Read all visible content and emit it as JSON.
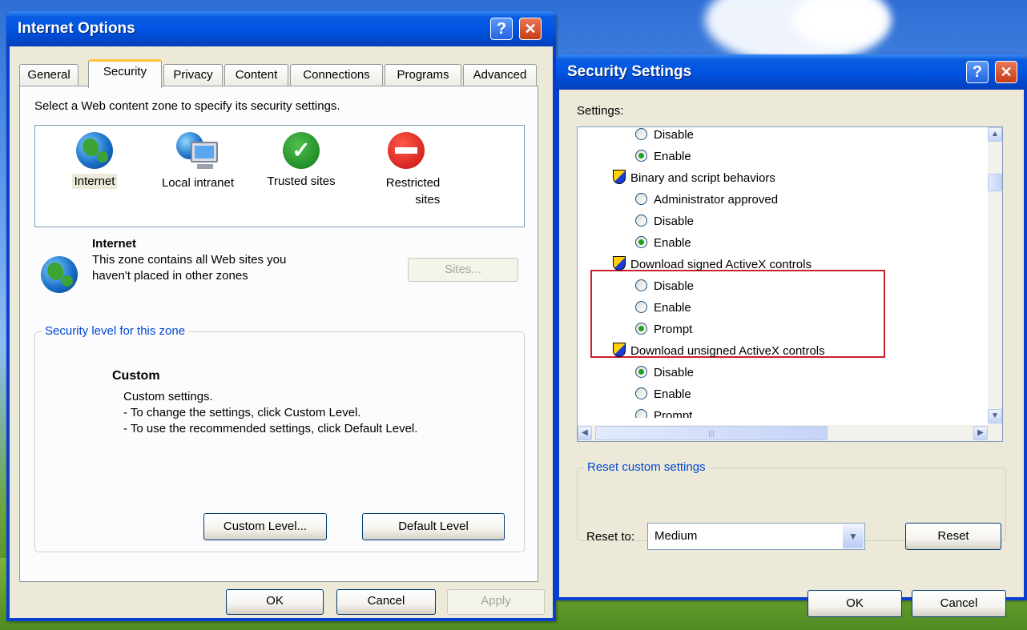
{
  "internet_options": {
    "title": "Internet Options",
    "help_glyph": "?",
    "close_glyph": "✕",
    "tabs": [
      "General",
      "Security",
      "Privacy",
      "Content",
      "Connections",
      "Programs",
      "Advanced"
    ],
    "active_tab": "Security",
    "zone_prompt": "Select a Web content zone to specify its security settings.",
    "zones": [
      {
        "label": "Internet",
        "icon": "globe-icon",
        "selected": true
      },
      {
        "label": "Local intranet",
        "icon": "intranet-icon",
        "selected": false
      },
      {
        "label": "Trusted sites",
        "icon": "check-icon",
        "selected": false
      },
      {
        "label": "Restricted\nsites",
        "icon": "restricted-icon",
        "selected": false
      }
    ],
    "zone_info": {
      "title": "Internet",
      "line1": "This zone contains all Web sites you",
      "line2": "haven't placed in other zones",
      "sites_button": "Sites..."
    },
    "security_level": {
      "legend": "Security level for this zone",
      "level": "Custom",
      "line1": "Custom settings.",
      "line2": "- To change the settings, click Custom Level.",
      "line3": "- To use the recommended settings, click Default Level.",
      "custom_button": "Custom Level...",
      "default_button": "Default Level"
    },
    "buttons": {
      "ok": "OK",
      "cancel": "Cancel",
      "apply": "Apply"
    }
  },
  "security_settings": {
    "title": "Security Settings",
    "help_glyph": "?",
    "close_glyph": "✕",
    "settings_label": "Settings:",
    "tree": [
      {
        "type": "option",
        "label": "Disable",
        "checked": false
      },
      {
        "type": "option",
        "label": "Enable",
        "checked": true
      },
      {
        "type": "group",
        "label": "Binary and script behaviors"
      },
      {
        "type": "option",
        "label": "Administrator approved",
        "checked": false
      },
      {
        "type": "option",
        "label": "Disable",
        "checked": false
      },
      {
        "type": "option",
        "label": "Enable",
        "checked": true
      },
      {
        "type": "group",
        "label": "Download signed ActiveX controls"
      },
      {
        "type": "option",
        "label": "Disable",
        "checked": false
      },
      {
        "type": "option",
        "label": "Enable",
        "checked": false
      },
      {
        "type": "option",
        "label": "Prompt",
        "checked": true
      },
      {
        "type": "group",
        "label": "Download unsigned ActiveX controls"
      },
      {
        "type": "option",
        "label": "Disable",
        "checked": true
      },
      {
        "type": "option",
        "label": "Enable",
        "checked": false
      },
      {
        "type": "option",
        "label": "Prompt",
        "checked": false
      }
    ],
    "scroll": {
      "up": "▲",
      "down": "▼",
      "left": "◀",
      "right": "▶",
      "grip": "|||"
    },
    "reset": {
      "legend": "Reset custom settings",
      "reset_to_label": "Reset to:",
      "selected": "Medium",
      "drop_glyph": "▼",
      "reset_button": "Reset"
    },
    "buttons": {
      "ok": "OK",
      "cancel": "Cancel"
    }
  },
  "colors": {
    "title_bar": "#0054e3",
    "dialog_face": "#ece9d8",
    "group_label": "#0046d5",
    "highlight_box": "#c9212a",
    "radio_dot": "#21a121"
  }
}
